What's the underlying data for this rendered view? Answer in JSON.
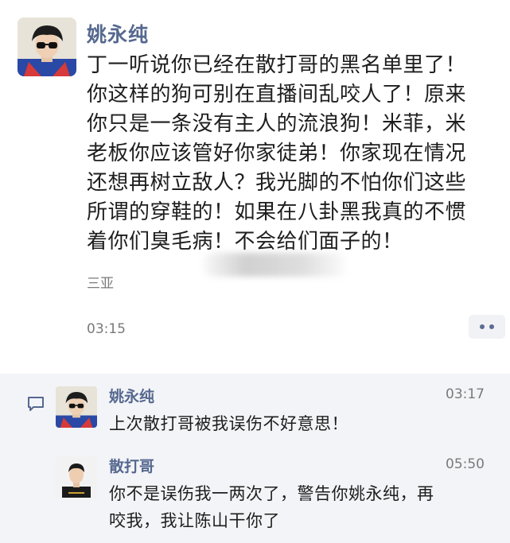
{
  "post": {
    "author": "姚永纯",
    "text": "丁一听说你已经在散打哥的黑名单里了！\n你这样的狗可别在直播间乱咬人了！原来\n你只是一条没有主人的流浪狗！米菲，米\n老板你应该管好你家徒弟！你家现在情况\n还想再树立敌人？我光脚的不怕你们这些\n所谓的穿鞋的！如果在八卦黑我真的不惯\n着你们臭毛病！不会给们面子的！",
    "location": "三亚",
    "time": "03:15",
    "more_icon": "more-dots-icon"
  },
  "comments": [
    {
      "author": "姚永纯",
      "time": "03:17",
      "text": "上次散打哥被我误伤不好意思！"
    },
    {
      "author": "散打哥",
      "time": "05:50",
      "text": "你不是误伤我一两次了，警告你姚永纯，再\n咬我，我让陈山干你了"
    }
  ],
  "colors": {
    "name": "#56688f",
    "comment_bg": "#f3f4f7",
    "meta": "#7a7a7a"
  }
}
